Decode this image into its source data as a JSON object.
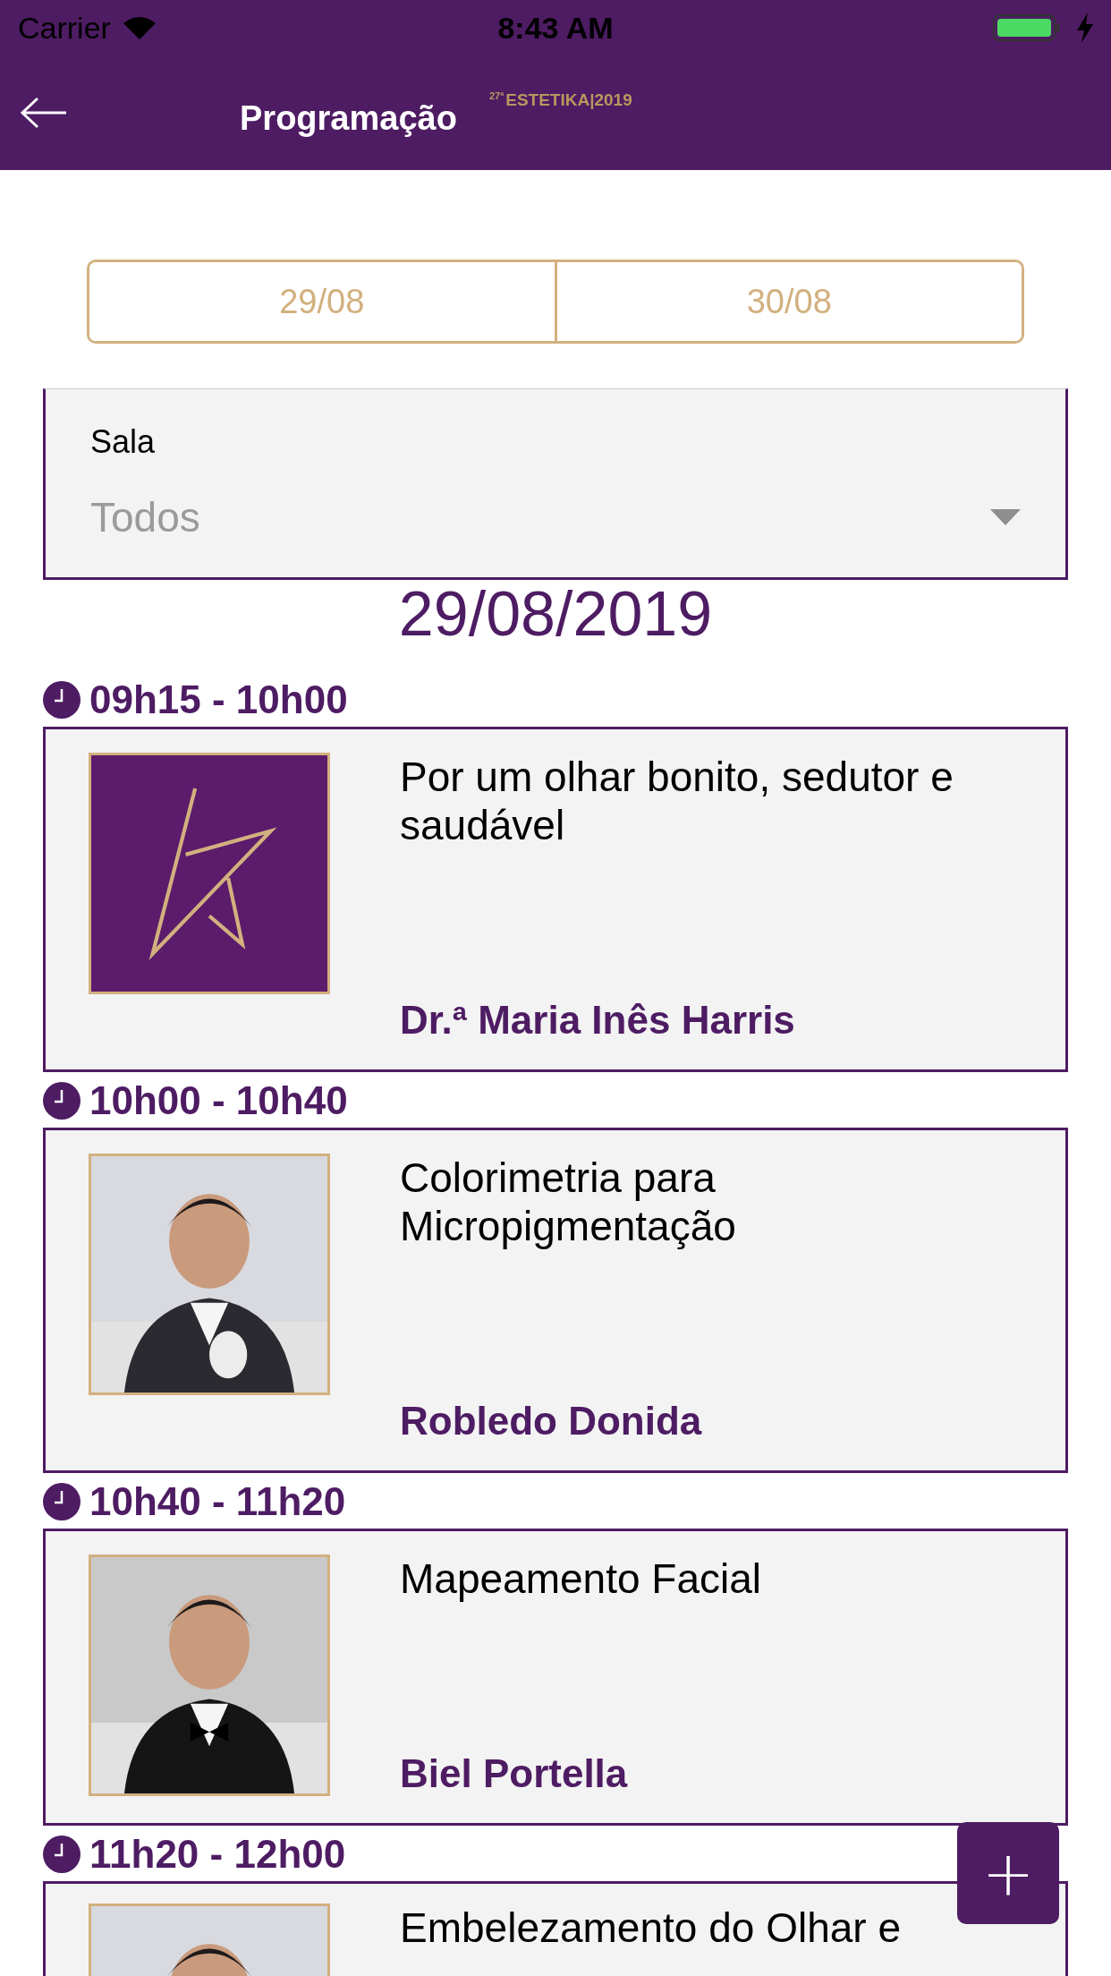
{
  "status_bar": {
    "carrier": "Carrier",
    "time": "8:43 AM"
  },
  "header": {
    "title": "Programação",
    "logo_edition": "27ª",
    "logo_name": "ESTETIKA|2019"
  },
  "date_tabs": [
    {
      "label": "29/08",
      "selected": false
    },
    {
      "label": "30/08",
      "selected": false
    }
  ],
  "room_filter": {
    "label": "Sala",
    "value": "Todos"
  },
  "day_title": "29/08/2019",
  "sessions": [
    {
      "time": "09h15 - 10h00",
      "title": "Por um olhar bonito, sedutor e saudável",
      "speaker": "Dr.ª Maria Inês Harris",
      "kind": "logo"
    },
    {
      "time": "10h00 - 10h40",
      "title": "Colorimetria para Micropigmentação",
      "speaker": "Robledo Donida",
      "kind": "picture"
    },
    {
      "time": "10h40 - 11h20",
      "title": "Mapeamento Facial",
      "speaker": "Biel Portella",
      "kind": "picture"
    },
    {
      "time": "11h20 - 12h00",
      "title": "Embelezamento do Olhar e",
      "kind": "picture"
    }
  ],
  "fab": {
    "label": "+"
  }
}
